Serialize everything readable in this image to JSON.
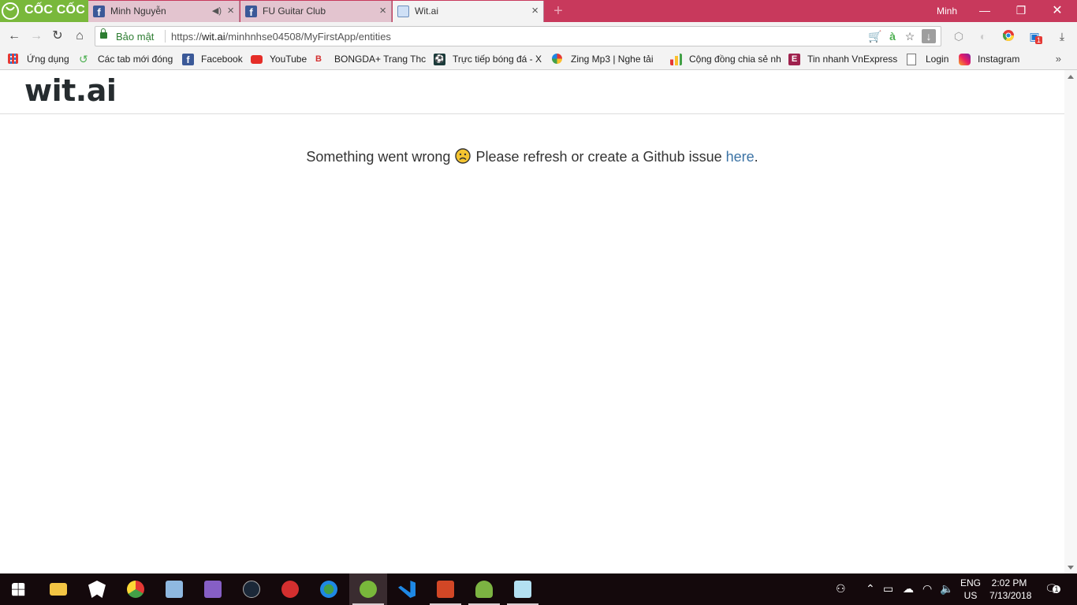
{
  "browser": {
    "logo_text": "CỐC CỐC",
    "user_name": "Minh",
    "tabs": [
      {
        "title": "Minh Nguyễn",
        "favicon": "facebook-icon",
        "muted_audio": true
      },
      {
        "title": "FU Guitar Club",
        "favicon": "facebook-icon"
      },
      {
        "title": "Wit.ai",
        "favicon": "wit-icon",
        "active": true
      }
    ],
    "address": {
      "security_label": "Bảo mật",
      "url_prefix": "https://",
      "url_host": "wit.ai",
      "url_path": "/minhnhse04508/MyFirstApp/entities"
    },
    "bookmarks": [
      {
        "label": "Ứng dụng",
        "icon": "apps-grid-icon"
      },
      {
        "label": "Các tab mới đóng",
        "icon": "recent-tabs-icon"
      },
      {
        "label": "Facebook",
        "icon": "facebook-icon"
      },
      {
        "label": "YouTube",
        "icon": "youtube-icon"
      },
      {
        "label": "BONGDA+ Trang Thc",
        "icon": "bongda-icon"
      },
      {
        "label": "Trực tiếp bóng đá - X",
        "icon": "football-icon"
      },
      {
        "label": "Zing Mp3 | Nghe tải",
        "icon": "zing-icon"
      },
      {
        "label": "Cộng đồng chia sẻ nh",
        "icon": "chart-icon"
      },
      {
        "label": "Tin nhanh VnExpress",
        "icon": "vnexpress-icon"
      },
      {
        "label": "Login",
        "icon": "page-icon"
      },
      {
        "label": "Instagram",
        "icon": "instagram-icon"
      }
    ],
    "extension_badge": "1"
  },
  "page": {
    "brand": "wit.ai",
    "error": {
      "part1": "Something went wrong",
      "part2": "Please refresh or create a Github issue",
      "link": "here",
      "end": "."
    }
  },
  "taskbar": {
    "apps": [
      "start-icon",
      "file-explorer-icon",
      "app-icon",
      "chrome-icon",
      "box-icon",
      "visual-studio-icon",
      "steam-icon",
      "garena-icon",
      "internet-download-icon",
      "coccoc-icon",
      "vscode-icon",
      "powerpoint-icon",
      "android-studio-icon",
      "notepad-icon"
    ],
    "lang_line1": "ENG",
    "lang_line2": "US",
    "time": "2:02 PM",
    "date": "7/13/2018",
    "notification_count": "1"
  },
  "colors": {
    "titlebar": "#c8395c",
    "logo": "#79b83b",
    "link": "#3b73a5",
    "taskbar": "#14090c"
  }
}
